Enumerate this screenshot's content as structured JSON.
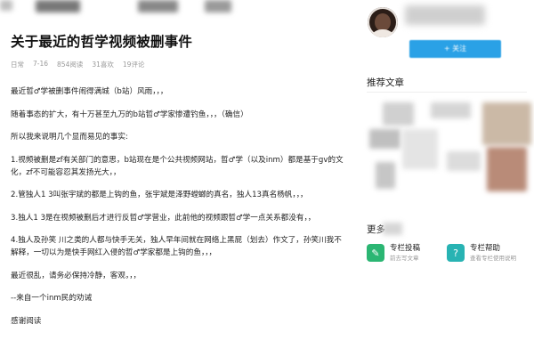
{
  "article": {
    "title": "关于最近的哲学视频被删事件",
    "meta": {
      "category": "日常",
      "date": "7-16",
      "reads": "854阅读",
      "likes": "31喜欢",
      "comments": "19评论"
    },
    "paragraphs": [
      "最近哲♂学被删事件闹得满城（b站）风雨，，，",
      "随着事态的扩大，有十万甚至九万的b站哲♂学家惨遭钓鱼，，，（确信）",
      "所以我来说明几个显而易见的事实:",
      "1.视频被删是zf有关部门的意思，b站现在是个公共视频网站，哲♂学（以及inm）都是基于gv的文化，zf不可能容忍其发扬光大，，",
      "2.管独人1 3叫张宇斌的都是上钩的鱼，张宇斌是泽野螳螂的真名，独人13真名杨帆，，，",
      "3.独人1 3是在视频被删后才进行反哲♂学营业，此前他的视频跟哲♂学一点关系都没有，，",
      "4.独人及孙笑 川之类的人都与快手无关，独人早年间就在网络上黑屁（划去）作文了，孙笑川我不解释，一切以为是快手网红入侵的哲♂学家都是上钩的鱼，，，",
      "最近很乱，请务必保持冷静，客观，，，",
      "--来自一个inm民的劝诫",
      "感谢阅读"
    ]
  },
  "sidebar": {
    "follow_label": "+ 关注",
    "recommend_title": "推荐文章",
    "more_title": "更多",
    "help": [
      {
        "title": "专栏投稿",
        "subtitle": "前去写文章",
        "icon": "edit-icon",
        "color": "#2bb673"
      },
      {
        "title": "专栏帮助",
        "subtitle": "查看专栏使用说明",
        "icon": "help-icon",
        "color": "#28b3b3"
      }
    ]
  }
}
